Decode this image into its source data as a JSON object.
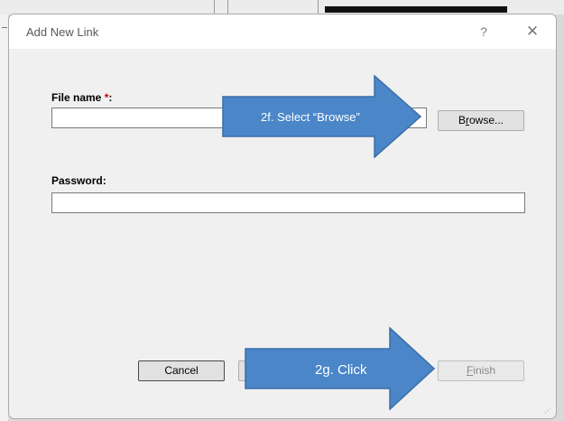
{
  "dialog": {
    "title": "Add New Link",
    "help_glyph": "?",
    "close_glyph": "✕"
  },
  "form": {
    "file_name_label": "File name",
    "required_marker": "*",
    "label_colon": ":",
    "file_name_value": "",
    "password_label": "Password:",
    "password_value": ""
  },
  "buttons": {
    "browse_prefix": "B",
    "browse_underlined": "r",
    "browse_suffix": "owse...",
    "cancel_label": "Cancel",
    "finish_underlined": "F",
    "finish_suffix": "inish"
  },
  "annotations": {
    "browse_callout": "2f. Select “Browse”",
    "finish_callout": "2g. Click"
  },
  "colors": {
    "arrow_fill": "#4a86c8",
    "arrow_stroke": "#3a6ea5",
    "required": "#d00000"
  }
}
